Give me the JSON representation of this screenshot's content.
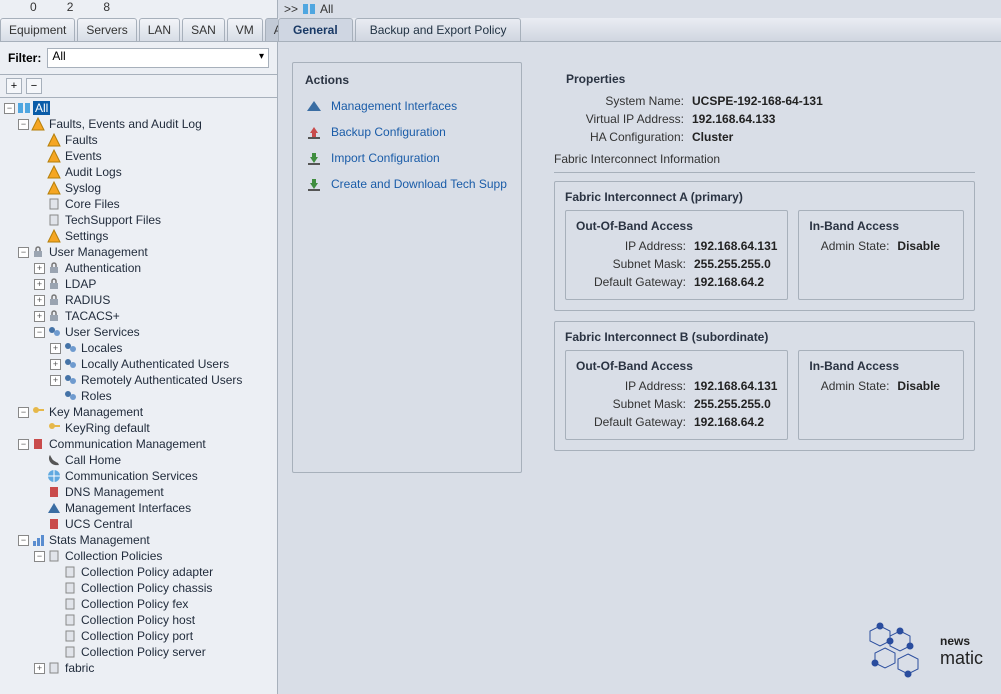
{
  "counts": {
    "a": "0",
    "b": "2",
    "c": "8"
  },
  "navTabs": [
    "Equipment",
    "Servers",
    "LAN",
    "SAN",
    "VM",
    "Admin"
  ],
  "activeNavTab": 5,
  "filter": {
    "label": "Filter:",
    "value": "All"
  },
  "tree": {
    "root": "All",
    "faults": {
      "label": "Faults, Events and Audit Log",
      "children": [
        "Faults",
        "Events",
        "Audit Logs",
        "Syslog",
        "Core Files",
        "TechSupport Files",
        "Settings"
      ]
    },
    "user": {
      "label": "User Management",
      "children": [
        "Authentication",
        "LDAP",
        "RADIUS",
        "TACACS+"
      ],
      "services": {
        "label": "User Services",
        "children": [
          "Locales",
          "Locally Authenticated Users",
          "Remotely Authenticated Users",
          "Roles"
        ]
      }
    },
    "key": {
      "label": "Key Management",
      "children": [
        "KeyRing default"
      ]
    },
    "comm": {
      "label": "Communication Management",
      "children": [
        "Call Home",
        "Communication Services",
        "DNS Management",
        "Management Interfaces",
        "UCS Central"
      ]
    },
    "stats": {
      "label": "Stats Management",
      "coll": {
        "label": "Collection Policies",
        "children": [
          "Collection Policy adapter",
          "Collection Policy chassis",
          "Collection Policy fex",
          "Collection Policy host",
          "Collection Policy port",
          "Collection Policy server"
        ]
      },
      "fabric": "fabric"
    }
  },
  "breadcrumb": {
    "prefix": ">>",
    "label": "All"
  },
  "subTabs": [
    "General",
    "Backup and Export Policy"
  ],
  "activeSubTab": 0,
  "actions": {
    "title": "Actions",
    "items": [
      "Management Interfaces",
      "Backup Configuration",
      "Import Configuration",
      "Create and Download Tech Supp"
    ]
  },
  "properties": {
    "title": "Properties",
    "systemNameLabel": "System Name:",
    "systemName": "UCSPE-192-168-64-131",
    "vipLabel": "Virtual IP Address:",
    "vip": "192.168.64.133",
    "haLabel": "HA Configuration:",
    "ha": "Cluster",
    "fiInfoLabel": "Fabric Interconnect Information"
  },
  "fiA": {
    "title": "Fabric Interconnect A (primary)",
    "oobTitle": "Out-Of-Band Access",
    "ipLabel": "IP Address:",
    "ip": "192.168.64.131",
    "maskLabel": "Subnet Mask:",
    "mask": "255.255.255.0",
    "gwLabel": "Default Gateway:",
    "gw": "192.168.64.2",
    "inbandTitle": "In-Band Access",
    "adminLabel": "Admin State:",
    "admin": "Disable"
  },
  "fiB": {
    "title": "Fabric Interconnect B (subordinate)",
    "oobTitle": "Out-Of-Band Access",
    "ipLabel": "IP Address:",
    "ip": "192.168.64.131",
    "maskLabel": "Subnet Mask:",
    "mask": "255.255.255.0",
    "gwLabel": "Default Gateway:",
    "gw": "192.168.64.2",
    "inbandTitle": "In-Band Access",
    "adminLabel": "Admin State:",
    "admin": "Disable"
  },
  "watermark": {
    "main": "news",
    "sub": "matic"
  }
}
